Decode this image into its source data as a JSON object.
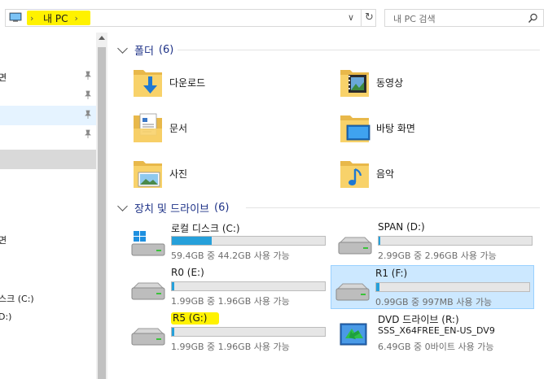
{
  "address": {
    "crumb": "내 PC",
    "search_placeholder": "내 PC 검색"
  },
  "nav": {
    "rows": [
      {
        "label": "면",
        "pinned": true
      },
      {
        "label": "",
        "pinned": true
      },
      {
        "label": "",
        "pinned": true
      },
      {
        "label": "",
        "pinned": true
      },
      {
        "label": "",
        "pinned": false
      },
      {
        "label": "",
        "pinned": false
      },
      {
        "label": "",
        "pinned": false
      },
      {
        "label": "",
        "pinned": false
      },
      {
        "label": "",
        "pinned": false
      },
      {
        "label": "면",
        "pinned": false
      },
      {
        "label": "",
        "pinned": false
      },
      {
        "label": "스크 (C:)",
        "pinned": false
      },
      {
        "label": "D:)",
        "pinned": false
      }
    ]
  },
  "folders_group": {
    "title": "폴더",
    "count": "(6)",
    "items": [
      {
        "name": "다운로드",
        "icon": "downloads-folder-icon"
      },
      {
        "name": "동영상",
        "icon": "videos-folder-icon"
      },
      {
        "name": "문서",
        "icon": "documents-folder-icon"
      },
      {
        "name": "바탕 화면",
        "icon": "desktop-folder-icon"
      },
      {
        "name": "사진",
        "icon": "pictures-folder-icon"
      },
      {
        "name": "음악",
        "icon": "music-folder-icon"
      }
    ]
  },
  "drives_group": {
    "title": "장치 및 드라이브",
    "count": "(6)",
    "items": [
      {
        "name": "로컬 디스크 (C:)",
        "info": "59.4GB 중 44.2GB 사용 가능",
        "used_fraction": 0.26,
        "icon": "windows-drive-icon"
      },
      {
        "name": "SPAN (D:)",
        "info": "2.99GB 중 2.96GB 사용 가능",
        "used_fraction": 0.01,
        "icon": "hard-drive-icon"
      },
      {
        "name": "R0 (E:)",
        "info": "1.99GB 중 1.96GB 사용 가능",
        "used_fraction": 0.015,
        "icon": "hard-drive-icon"
      },
      {
        "name": "R1 (F:)",
        "info": "0.99GB 중 997MB 사용 가능",
        "used_fraction": 0.02,
        "icon": "hard-drive-icon",
        "selected": true
      },
      {
        "name": "R5 (G:)",
        "info": "1.99GB 중 1.96GB 사용 가능",
        "used_fraction": 0.015,
        "icon": "hard-drive-icon",
        "highlighted": true
      },
      {
        "name": "DVD 드라이브 (R:)",
        "sub": "SSS_X64FREE_EN-US_DV9",
        "info": "6.49GB 중 0바이트 사용 가능",
        "icon": "dvd-drive-icon"
      }
    ]
  },
  "colors": {
    "accent_blue": "#26a0da",
    "group_title": "#1e3287",
    "selection_bg": "#cce8ff",
    "highlighter": "#fff200"
  }
}
